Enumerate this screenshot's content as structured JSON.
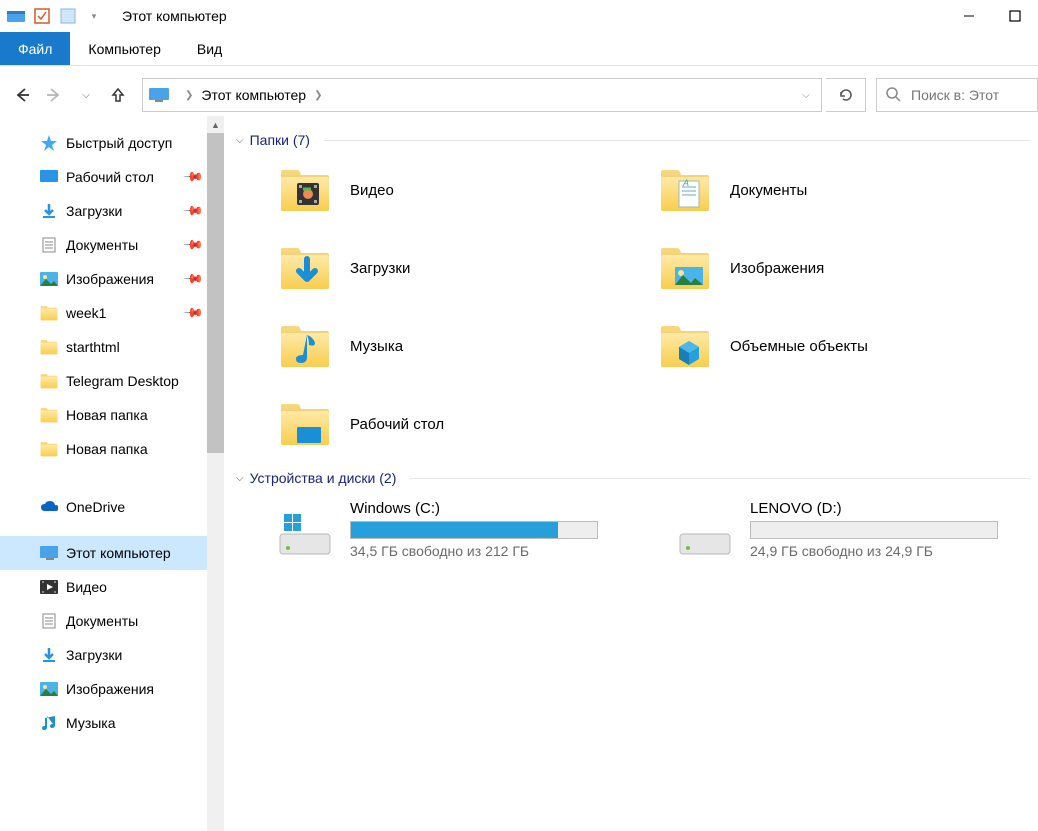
{
  "titlebar": {
    "title": "Этот компьютер"
  },
  "ribbon": {
    "file": "Файл",
    "computer": "Компьютер",
    "view": "Вид"
  },
  "address": {
    "location": "Этот компьютер",
    "search_placeholder": "Поиск в: Этот"
  },
  "sidebar": {
    "quick_access": "Быстрый доступ",
    "items": [
      {
        "label": "Рабочий стол",
        "pinned": true,
        "icon": "desktop"
      },
      {
        "label": "Загрузки",
        "pinned": true,
        "icon": "downloads"
      },
      {
        "label": "Документы",
        "pinned": true,
        "icon": "documents"
      },
      {
        "label": "Изображения",
        "pinned": true,
        "icon": "pictures"
      },
      {
        "label": "week1",
        "pinned": true,
        "icon": "folder"
      },
      {
        "label": "starthtml",
        "pinned": false,
        "icon": "folder"
      },
      {
        "label": "Telegram Desktop",
        "pinned": false,
        "icon": "folder"
      },
      {
        "label": "Новая папка",
        "pinned": false,
        "icon": "folder"
      },
      {
        "label": "Новая папка",
        "pinned": false,
        "icon": "folder"
      }
    ],
    "onedrive": "OneDrive",
    "this_pc": "Этот компьютер",
    "pc_items": [
      {
        "label": "Видео",
        "icon": "videos"
      },
      {
        "label": "Документы",
        "icon": "documents"
      },
      {
        "label": "Загрузки",
        "icon": "downloads"
      },
      {
        "label": "Изображения",
        "icon": "pictures"
      },
      {
        "label": "Музыка",
        "icon": "music"
      }
    ]
  },
  "groups": {
    "folders_header": "Папки (7)",
    "folders": [
      {
        "label": "Видео",
        "icon": "videos"
      },
      {
        "label": "Документы",
        "icon": "documents"
      },
      {
        "label": "Загрузки",
        "icon": "downloads"
      },
      {
        "label": "Изображения",
        "icon": "pictures"
      },
      {
        "label": "Музыка",
        "icon": "music"
      },
      {
        "label": "Объемные объекты",
        "icon": "3d"
      },
      {
        "label": "Рабочий стол",
        "icon": "desktop"
      }
    ],
    "drives_header": "Устройства и диски (2)",
    "drives": [
      {
        "name": "Windows (C:)",
        "free": "34,5 ГБ свободно из 212 ГБ",
        "fill_pct": 84,
        "os": true
      },
      {
        "name": "LENOVO (D:)",
        "free": "24,9 ГБ свободно из 24,9 ГБ",
        "fill_pct": 0,
        "os": false
      }
    ]
  }
}
